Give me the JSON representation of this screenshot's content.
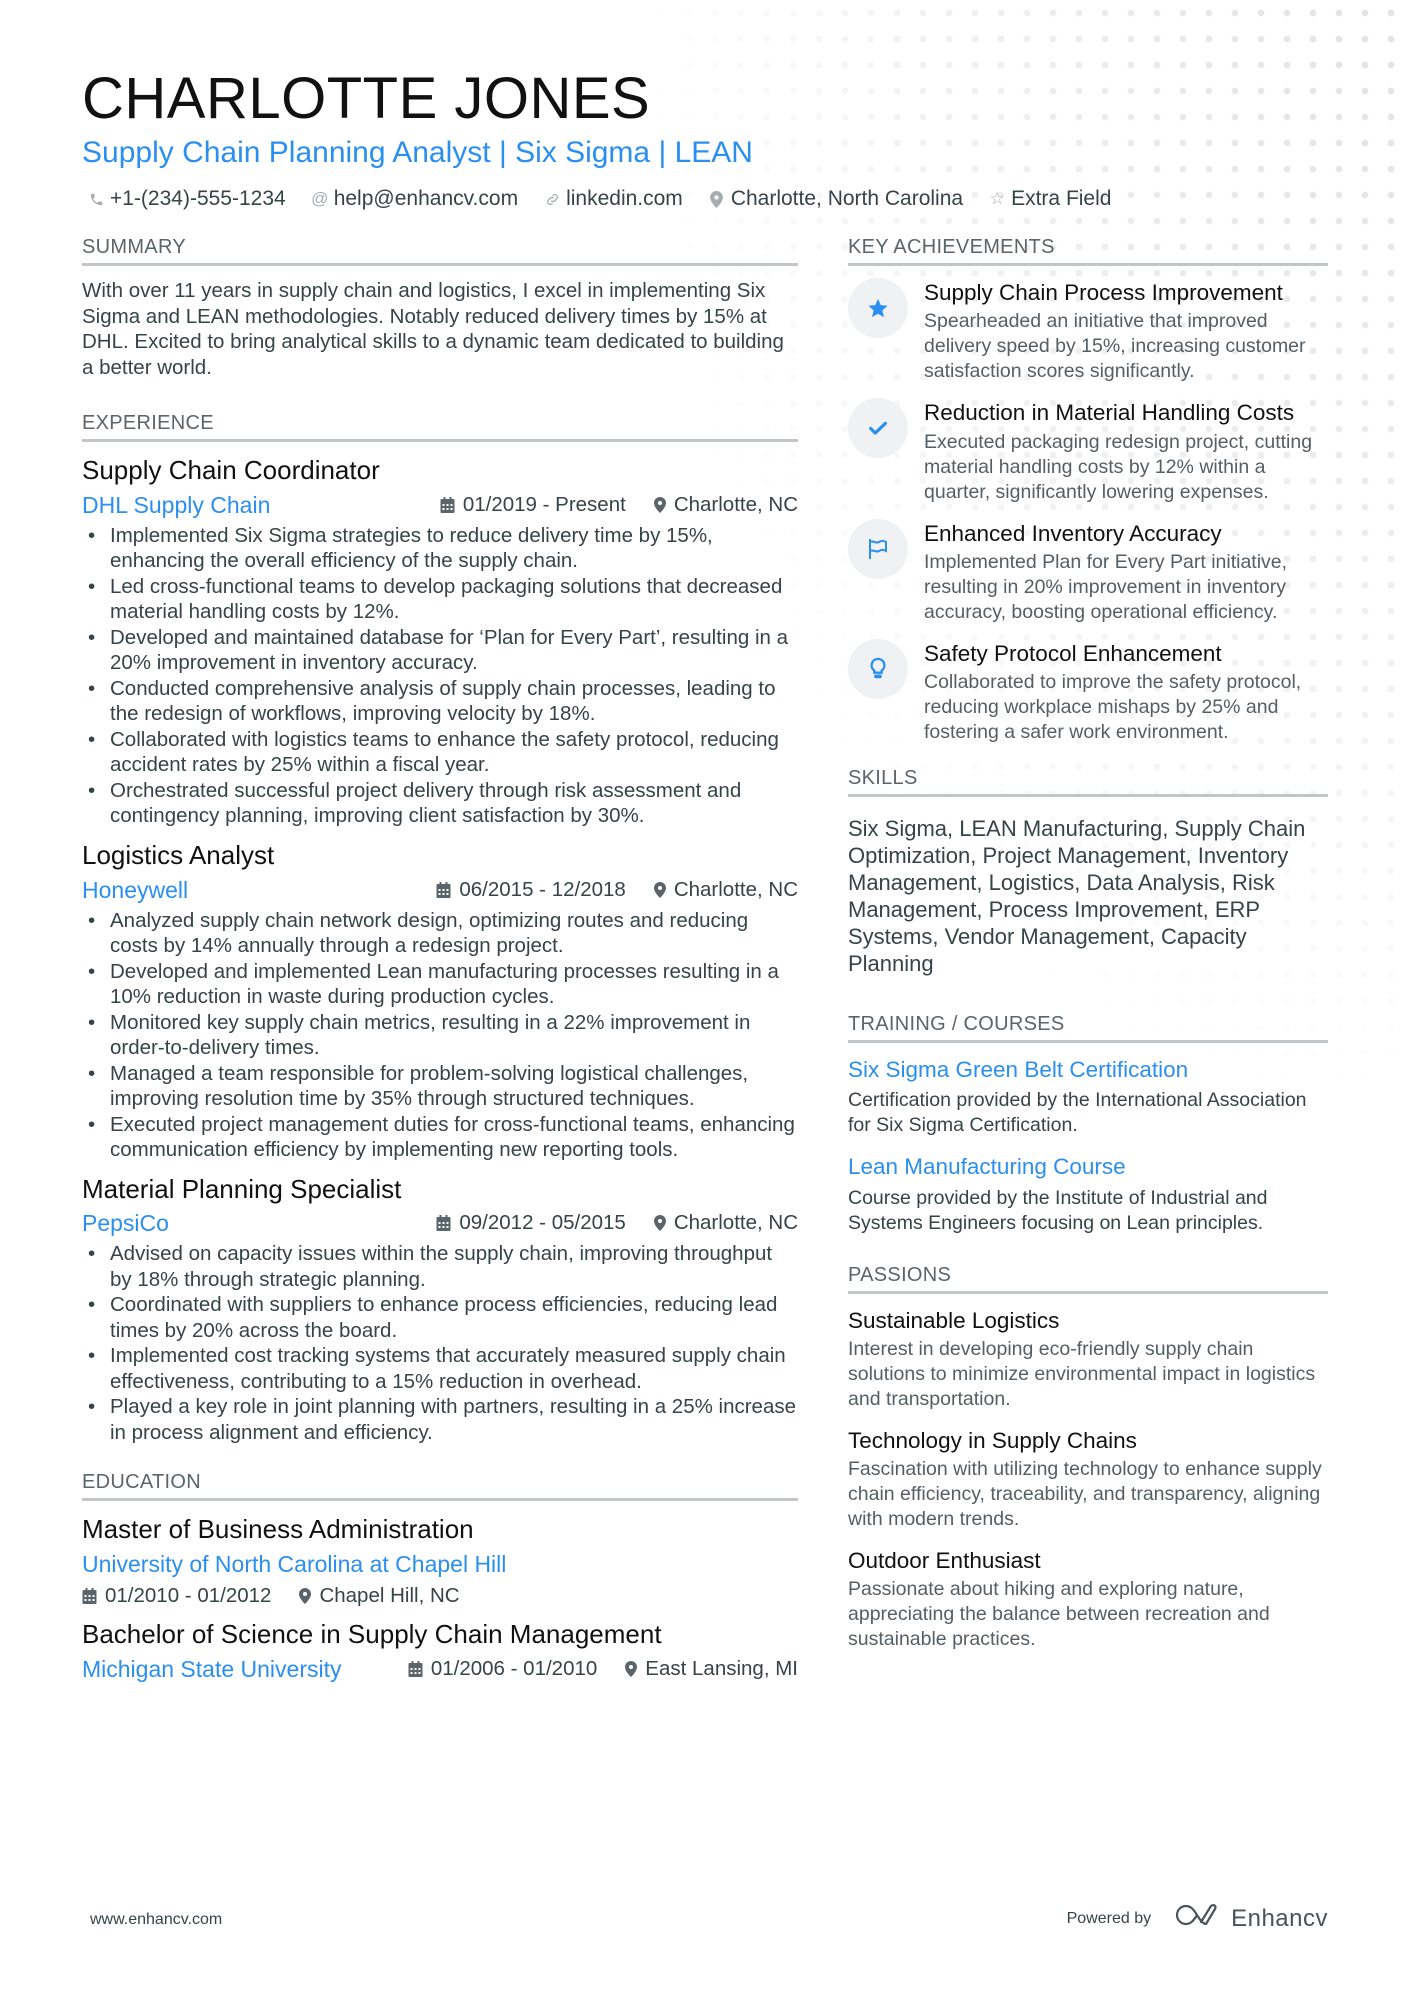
{
  "header": {
    "name": "CHARLOTTE JONES",
    "headline": "Supply Chain Planning Analyst | Six Sigma | LEAN",
    "contacts": [
      {
        "icon": "phone-icon",
        "text": "+1-(234)-555-1234"
      },
      {
        "icon": "at-icon",
        "text": "help@enhancv.com"
      },
      {
        "icon": "link-icon",
        "text": "linkedin.com"
      },
      {
        "icon": "location-icon",
        "text": "Charlotte, North Carolina"
      },
      {
        "icon": "star-icon",
        "text": "Extra Field"
      }
    ]
  },
  "summary": {
    "title": "SUMMARY",
    "text": "With over 11 years in supply chain and logistics, I excel in implementing Six Sigma and LEAN methodologies. Notably reduced delivery times by 15% at DHL. Excited to bring analytical skills to a dynamic team dedicated to building a better world."
  },
  "experience": {
    "title": "EXPERIENCE",
    "jobs": [
      {
        "title": "Supply Chain Coordinator",
        "company": "DHL Supply Chain",
        "dates": "01/2019 - Present",
        "location": "Charlotte, NC",
        "bullets": [
          "Implemented Six Sigma strategies to reduce delivery time by 15%, enhancing the overall efficiency of the supply chain.",
          "Led cross-functional teams to develop packaging solutions that decreased material handling costs by 12%.",
          "Developed and maintained database for ‘Plan for Every Part’, resulting in a 20% improvement in inventory accuracy.",
          "Conducted comprehensive analysis of supply chain processes, leading to the redesign of workflows, improving velocity by 18%.",
          "Collaborated with logistics teams to enhance the safety protocol, reducing accident rates by 25% within a fiscal year.",
          "Orchestrated successful project delivery through risk assessment and contingency planning, improving client satisfaction by 30%."
        ]
      },
      {
        "title": "Logistics Analyst",
        "company": "Honeywell",
        "dates": "06/2015 - 12/2018",
        "location": "Charlotte, NC",
        "bullets": [
          "Analyzed supply chain network design, optimizing routes and reducing costs by 14% annually through a redesign project.",
          "Developed and implemented Lean manufacturing processes resulting in a 10% reduction in waste during production cycles.",
          "Monitored key supply chain metrics, resulting in a 22% improvement in order-to-delivery times.",
          "Managed a team responsible for problem-solving logistical challenges, improving resolution time by 35% through structured techniques.",
          "Executed project management duties for cross-functional teams, enhancing communication efficiency by implementing new reporting tools."
        ]
      },
      {
        "title": "Material Planning Specialist",
        "company": "PepsiCo",
        "dates": "09/2012 - 05/2015",
        "location": "Charlotte, NC",
        "bullets": [
          "Advised on capacity issues within the supply chain, improving throughput by 18% through strategic planning.",
          "Coordinated with suppliers to enhance process efficiencies, reducing lead times by 20% across the board.",
          "Implemented cost tracking systems that accurately measured supply chain effectiveness, contributing to a 15% reduction in overhead.",
          "Played a key role in joint planning with partners, resulting in a 25% increase in process alignment and efficiency."
        ]
      }
    ]
  },
  "education": {
    "title": "EDUCATION",
    "items": [
      {
        "degree": "Master of Business Administration",
        "school": "University of North Carolina at Chapel Hill",
        "dates": "01/2010 - 01/2012",
        "location": "Chapel Hill, NC"
      },
      {
        "degree": "Bachelor of Science in Supply Chain Management",
        "school": "Michigan State University",
        "dates": "01/2006 - 01/2010",
        "location": "East Lansing, MI"
      }
    ]
  },
  "achievements": {
    "title": "KEY ACHIEVEMENTS",
    "items": [
      {
        "icon": "star-icon",
        "title": "Supply Chain Process Improvement",
        "desc": "Spearheaded an initiative that improved delivery speed by 15%, increasing customer satisfaction scores significantly."
      },
      {
        "icon": "checkmark-icon",
        "title": "Reduction in Material Handling Costs",
        "desc": "Executed packaging redesign project, cutting material handling costs by 12% within a quarter, significantly lowering expenses."
      },
      {
        "icon": "flag-icon",
        "title": "Enhanced Inventory Accuracy",
        "desc": "Implemented Plan for Every Part initiative, resulting in 20% improvement in inventory accuracy, boosting operational efficiency."
      },
      {
        "icon": "lightbulb-icon",
        "title": "Safety Protocol Enhancement",
        "desc": "Collaborated to improve the safety protocol, reducing workplace mishaps by 25% and fostering a safer work environment."
      }
    ]
  },
  "skills": {
    "title": "SKILLS",
    "text": "Six Sigma, LEAN Manufacturing, Supply Chain Optimization, Project Management, Inventory Management, Logistics, Data Analysis, Risk Management, Process Improvement, ERP Systems, Vendor Management, Capacity Planning"
  },
  "training": {
    "title": "TRAINING / COURSES",
    "items": [
      {
        "title": "Six Sigma Green Belt Certification",
        "desc": "Certification provided by the International Association for Six Sigma Certification."
      },
      {
        "title": "Lean Manufacturing Course",
        "desc": "Course provided by the Institute of Industrial and Systems Engineers focusing on Lean principles."
      }
    ]
  },
  "passions": {
    "title": "PASSIONS",
    "items": [
      {
        "title": "Sustainable Logistics",
        "desc": "Interest in developing eco-friendly supply chain solutions to minimize environmental impact in logistics and transportation."
      },
      {
        "title": "Technology in Supply Chains",
        "desc": "Fascination with utilizing technology to enhance supply chain efficiency, traceability, and transparency, aligning with modern trends."
      },
      {
        "title": "Outdoor Enthusiast",
        "desc": "Passionate about hiking and exploring nature, appreciating the balance between recreation and sustainable practices."
      }
    ]
  },
  "footer": {
    "website": "www.enhancv.com",
    "powered_by": "Powered by",
    "brand": "Enhancv"
  },
  "colors": {
    "accent": "#2a8ff0",
    "text": "#384347",
    "heading": "#111111",
    "rule": "#c2c6c9",
    "icon_bg": "#f0f1f2"
  }
}
